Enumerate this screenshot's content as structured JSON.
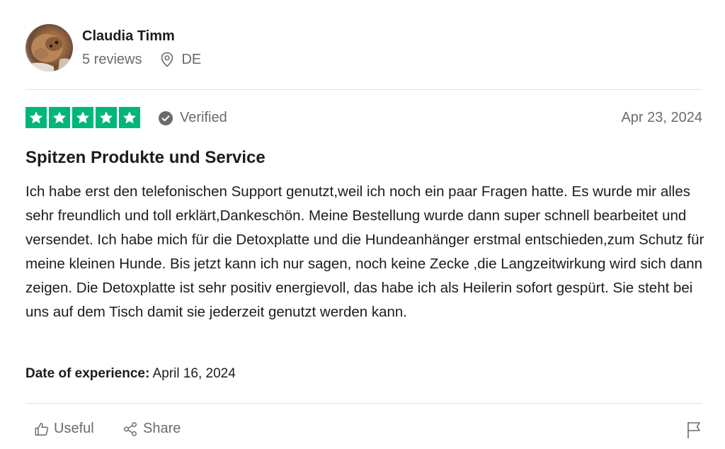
{
  "reviewer": {
    "name": "Claudia Timm",
    "reviews_count": "5 reviews",
    "country": "DE"
  },
  "rating": {
    "stars": 5,
    "star_color": "#00b67a",
    "verified_label": "Verified",
    "date": "Apr 23, 2024"
  },
  "review": {
    "title": "Spitzen Produkte und Service",
    "body": "Ich habe erst den telefonischen Support genutzt,weil ich noch ein paar Fragen hatte. Es wurde mir alles sehr freundlich und toll erklärt,Dankeschön. Meine Bestellung wurde dann super schnell bearbeitet und versendet. Ich habe mich für die Detoxplatte und die Hundeanhänger erstmal entschieden,zum Schutz für meine kleinen Hunde. Bis jetzt kann ich nur sagen, noch keine Zecke ,die Langzeitwirkung wird sich dann zeigen. Die Detoxplatte ist sehr positiv energievoll, das habe ich als Heilerin sofort gespürt. Sie steht bei uns auf dem Tisch damit sie jederzeit genutzt werden kann.",
    "experience_label": "Date of experience:",
    "experience_date": "April 16, 2024"
  },
  "actions": {
    "useful_label": "Useful",
    "share_label": "Share"
  },
  "icons": {
    "location": "location-pin-icon",
    "verified": "check-circle-icon",
    "useful": "thumbs-up-icon",
    "share": "share-icon",
    "report": "flag-icon"
  }
}
